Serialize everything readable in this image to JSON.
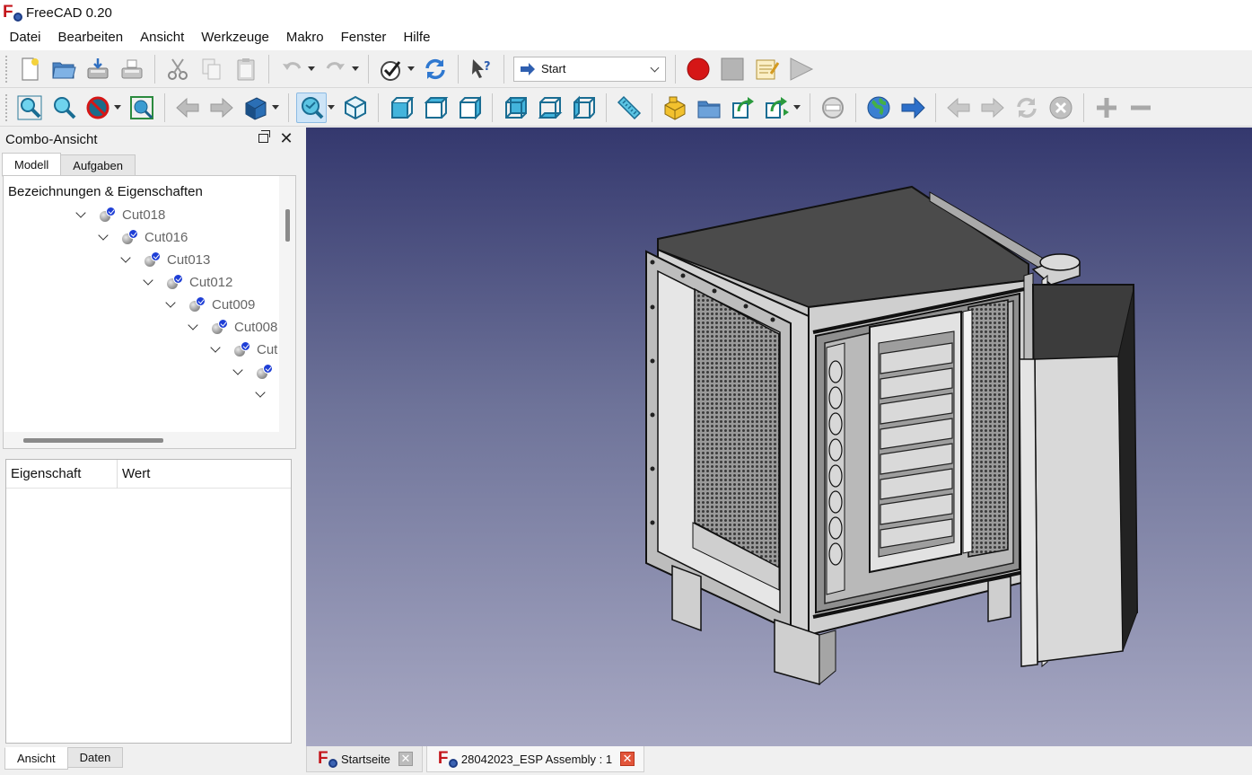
{
  "window": {
    "title": "FreeCAD 0.20",
    "logo_icon": "freecad-logo-icon"
  },
  "menu": [
    "Datei",
    "Bearbeiten",
    "Ansicht",
    "Werkzeuge",
    "Makro",
    "Fenster",
    "Hilfe"
  ],
  "toolbar": {
    "workbench": "Start"
  },
  "combo": {
    "title": "Combo-Ansicht",
    "tabs": [
      "Modell",
      "Aufgaben"
    ],
    "tree_heading": "Bezeichnungen & Eigenschaften",
    "tree_items": [
      {
        "label": "Cut018",
        "depth": 0
      },
      {
        "label": "Cut016",
        "depth": 1
      },
      {
        "label": "Cut013",
        "depth": 2
      },
      {
        "label": "Cut012",
        "depth": 3
      },
      {
        "label": "Cut009",
        "depth": 4
      },
      {
        "label": "Cut008",
        "depth": 5
      },
      {
        "label": "Cut",
        "depth": 6
      },
      {
        "label": "",
        "depth": 7
      },
      {
        "label": "",
        "depth": 8
      }
    ],
    "property_columns": [
      "Eigenschaft",
      "Wert"
    ],
    "bottom_tabs": [
      "Ansicht",
      "Daten"
    ]
  },
  "documents": [
    {
      "label": "Startseite",
      "close": "grey"
    },
    {
      "label": "28042023_ESP Assembly : 1",
      "close": "red"
    }
  ],
  "colors": {
    "accent_blue": "#1f3fd6",
    "logo_red": "#c4161c",
    "record_red": "#d51616"
  }
}
